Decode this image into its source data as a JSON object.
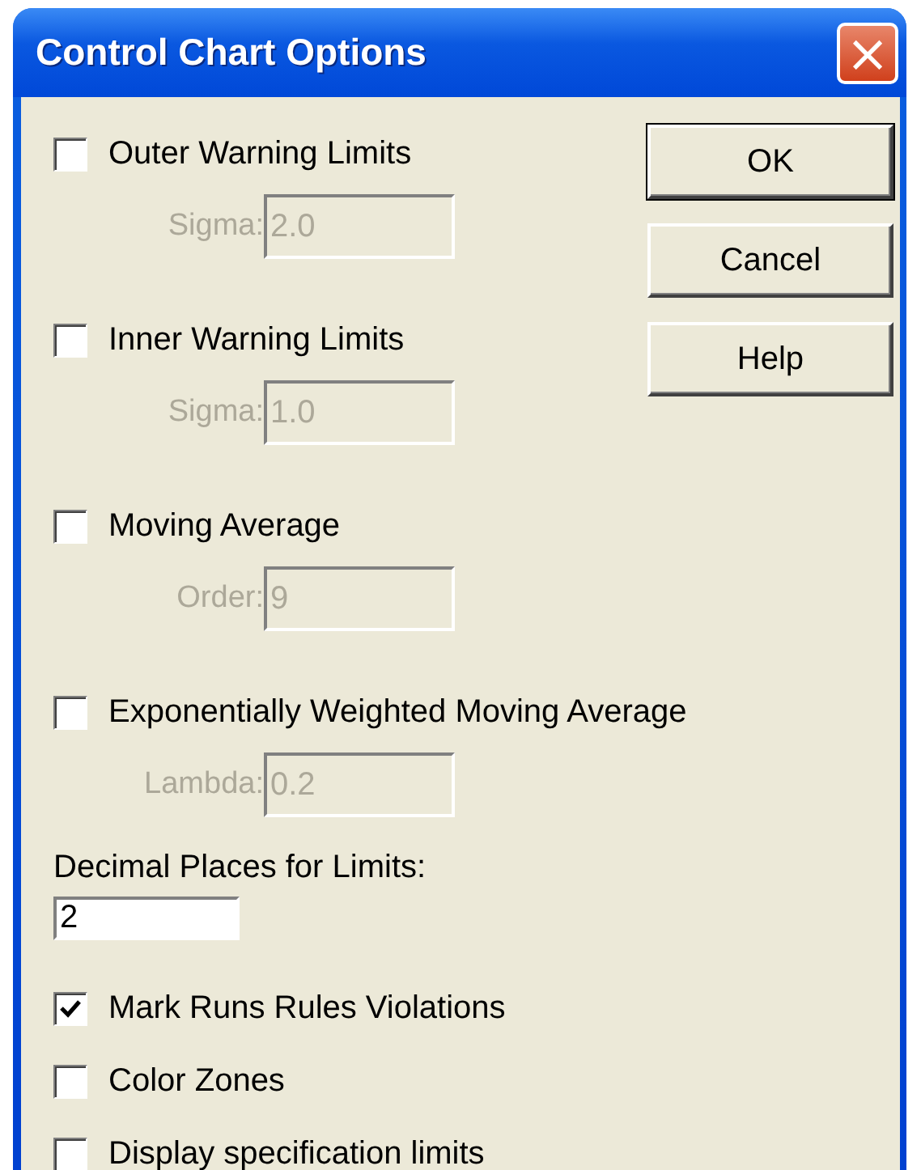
{
  "window": {
    "title": "Control Chart Options",
    "close": "×"
  },
  "options": [
    {
      "label": "Outer Warning Limits",
      "checked": false,
      "param": {
        "label": "Sigma:",
        "value": "2.0",
        "disabled": true
      }
    },
    {
      "label": "Inner Warning Limits",
      "checked": false,
      "param": {
        "label": "Sigma:",
        "value": "1.0",
        "disabled": true
      }
    },
    {
      "label": "Moving Average",
      "checked": false,
      "param": {
        "label": "Order:",
        "value": "9",
        "disabled": true
      }
    },
    {
      "label": "Exponentially Weighted Moving Average",
      "checked": false,
      "param": {
        "label": "Lambda:",
        "value": "0.2",
        "disabled": true
      }
    }
  ],
  "decimal_places": {
    "label": "Decimal Places for Limits:",
    "value": "2"
  },
  "checks": [
    {
      "label": "Mark Runs Rules Violations",
      "checked": true
    },
    {
      "label": "Color Zones",
      "checked": false
    },
    {
      "label": "Display specification limits",
      "checked": false
    }
  ],
  "buttons": [
    "OK",
    "Cancel",
    "Help"
  ]
}
